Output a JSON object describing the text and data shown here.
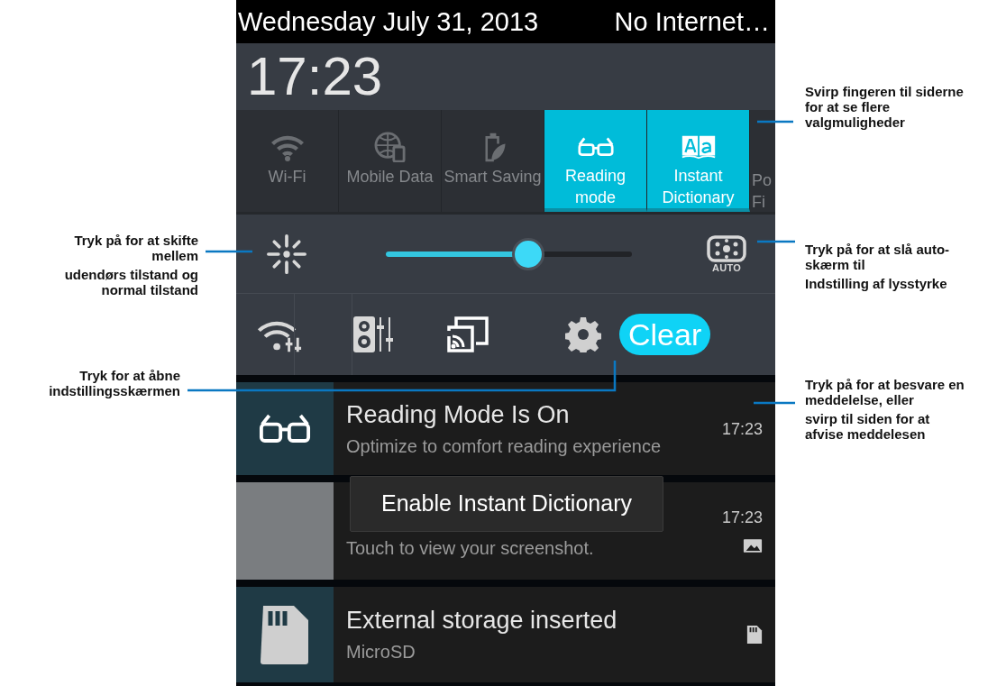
{
  "status_bar": {
    "date": "Wednesday July 31, 2013",
    "network": "No Internet…"
  },
  "clock": "17:23",
  "quick_settings": [
    {
      "label": "Wi-Fi",
      "selected": false
    },
    {
      "label": "Mobile Data",
      "selected": false
    },
    {
      "label": "Smart Saving",
      "selected": false
    },
    {
      "label": "Reading mode",
      "selected": true
    },
    {
      "label": "Instant Dictionary",
      "selected": true
    },
    {
      "label": "Po Fi",
      "selected": false
    }
  ],
  "brightness": {
    "level": 0.59,
    "auto_label": "AUTO"
  },
  "actions": {
    "clear": "Clear"
  },
  "notifications": [
    {
      "title": "Reading Mode Is On",
      "text": "Optimize to comfort reading experience",
      "time": "17:23"
    },
    {
      "text": "Touch to view your screenshot.",
      "time": "17:23"
    },
    {
      "title": "External storage inserted",
      "text": "MicroSD"
    }
  ],
  "toast": "Enable Instant Dictionary",
  "annotations": [
    {
      "paragraphs": [
        "Svirp fingeren til siderne for at se flere valgmuligheder"
      ]
    },
    {
      "paragraphs": [
        "Tryk på for at skifte mellem",
        "udendørs tilstand og normal tilstand"
      ]
    },
    {
      "paragraphs": [
        "Tryk på for at slå auto-skærm til",
        "Indstilling af lysstyrke"
      ]
    },
    {
      "paragraphs": [
        "Tryk for at åbne indstillingsskærmen"
      ]
    },
    {
      "paragraphs": [
        "Tryk på for at besvare en meddelelse, eller",
        "svirp til siden for at afvise meddelesen"
      ]
    }
  ]
}
